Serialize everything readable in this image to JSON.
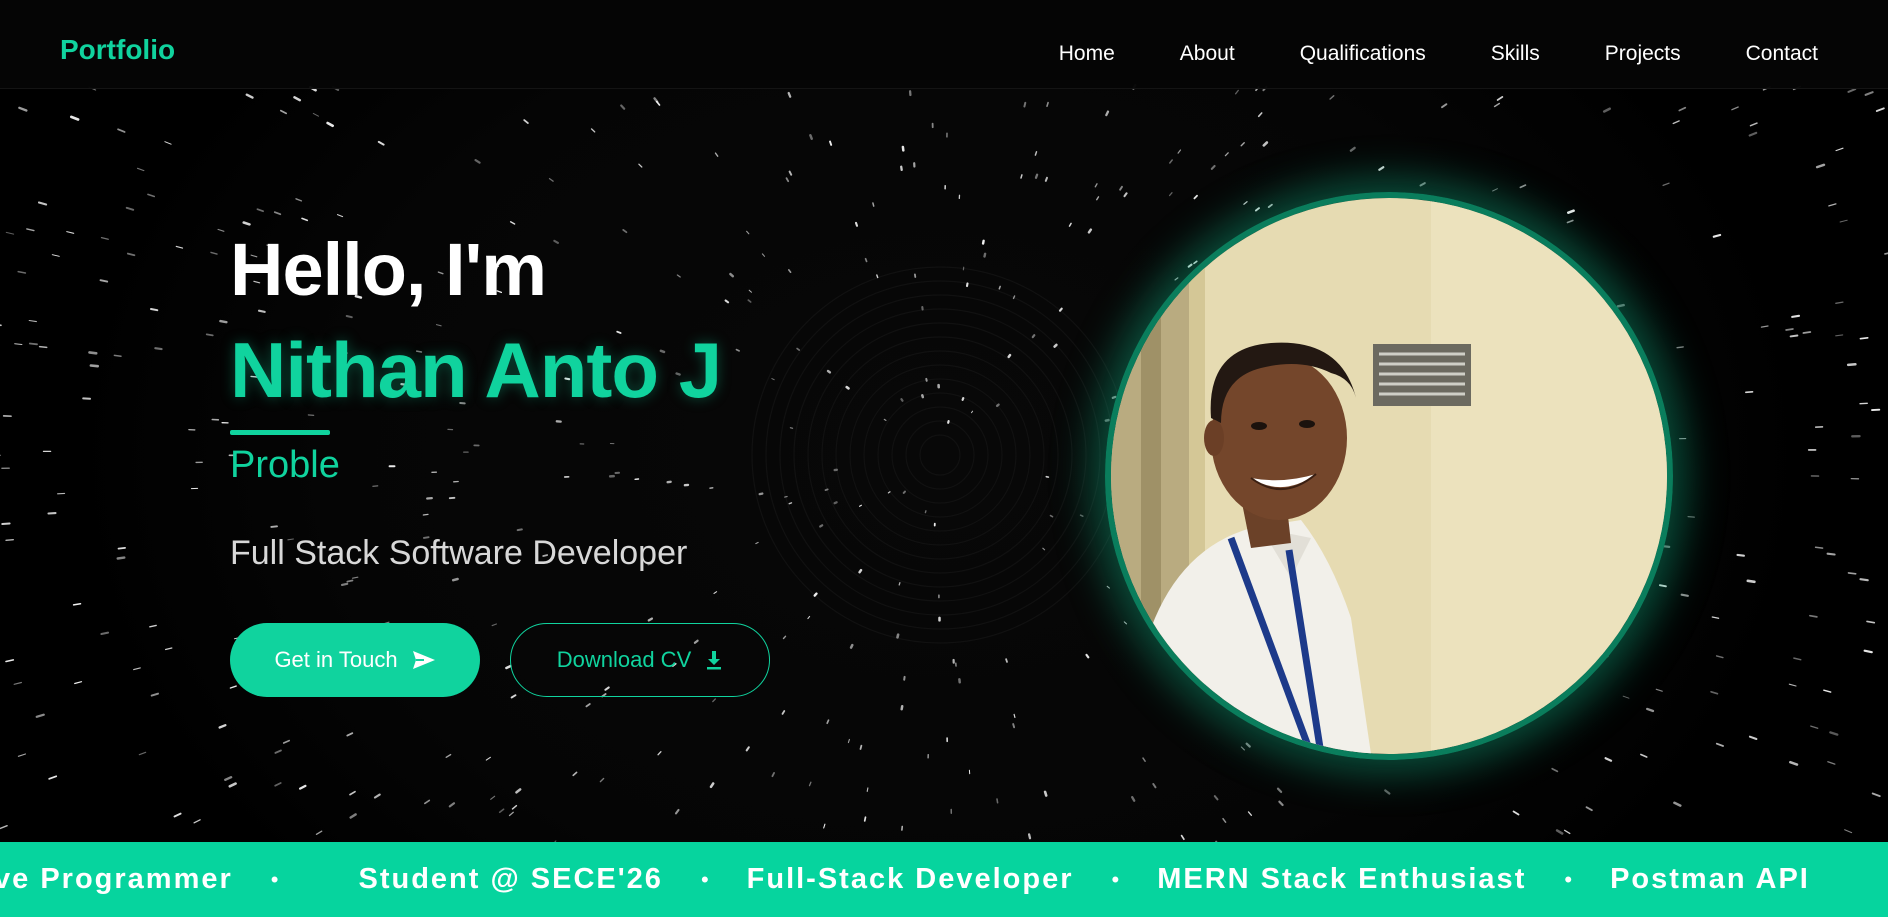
{
  "brand": "Portfolio",
  "nav": {
    "items": [
      "Home",
      "About",
      "Qualifications",
      "Skills",
      "Projects",
      "Contact"
    ]
  },
  "hero": {
    "greeting": "Hello, I'm",
    "name": "Nithan Anto J",
    "typed_text": "Proble",
    "role": "Full Stack Software Developer",
    "primary_button": "Get in Touch",
    "secondary_button": "Download CV"
  },
  "ticker": {
    "items": [
      "ve Programmer",
      "Student @ SECE'26",
      "Full-Stack Developer",
      "MERN Stack Enthusiast",
      "Postman API"
    ],
    "separator": "•"
  },
  "colors": {
    "accent": "#10d39e",
    "ticker_background": "#06d49e",
    "background": "#000000"
  },
  "icons": {
    "primary_button_icon": "send-icon",
    "secondary_button_icon": "download-icon"
  }
}
